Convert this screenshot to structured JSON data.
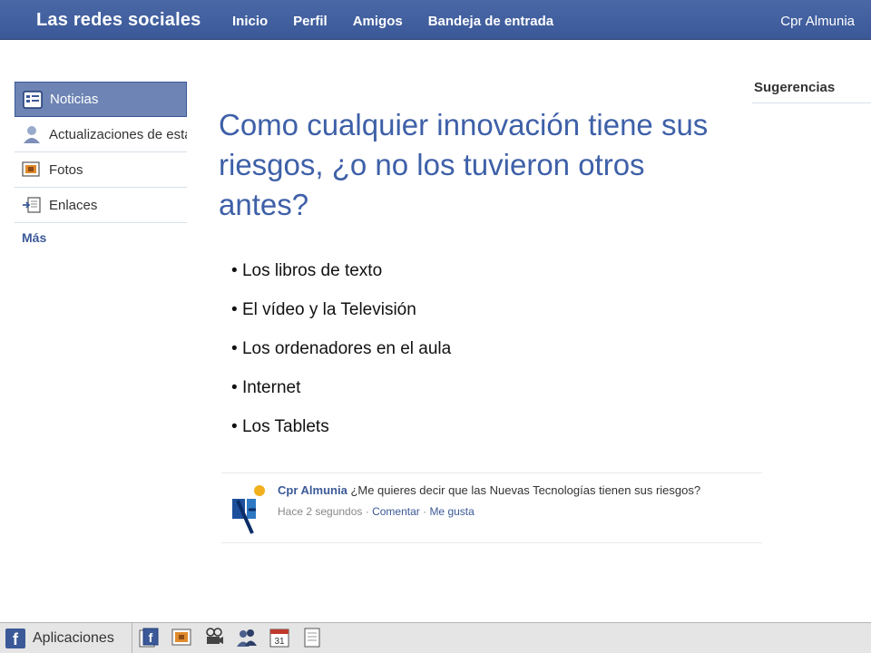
{
  "topbar": {
    "brand": "Las redes sociales",
    "nav": [
      "Inicio",
      "Perfil",
      "Amigos",
      "Bandeja de entrada"
    ],
    "user": "Cpr Almunia"
  },
  "sidebar": {
    "items": [
      {
        "label": "Noticias",
        "icon": "news-feed-icon",
        "active": true
      },
      {
        "label": "Actualizaciones de estado",
        "icon": "person-icon"
      },
      {
        "label": "Fotos",
        "icon": "photos-icon"
      },
      {
        "label": "Enlaces",
        "icon": "links-icon"
      }
    ],
    "more": "Más"
  },
  "suggestions": {
    "title": "Sugerencias"
  },
  "main": {
    "title": "Como cualquier innovación tiene sus riesgos, ¿o no los tuvieron otros antes?",
    "bullets": [
      "Los libros de texto",
      "El vídeo y la Televisión",
      "Los ordenadores en el aula",
      "Internet",
      "Los Tablets"
    ]
  },
  "post": {
    "author": "Cpr Almunia",
    "message": "¿Me quieres decir que las Nuevas Tecnologías tienen sus riesgos?",
    "time": "Hace 2 segundos",
    "separator": " · ",
    "comment": "Comentar",
    "like": "Me gusta"
  },
  "bottombar": {
    "apps_label": "Aplicaciones",
    "logo_letter": "f",
    "calendar_day": "31"
  },
  "colors": {
    "brand_blue": "#3b5998",
    "title_blue": "#3e60a8",
    "active_item": "#6d84b4"
  }
}
